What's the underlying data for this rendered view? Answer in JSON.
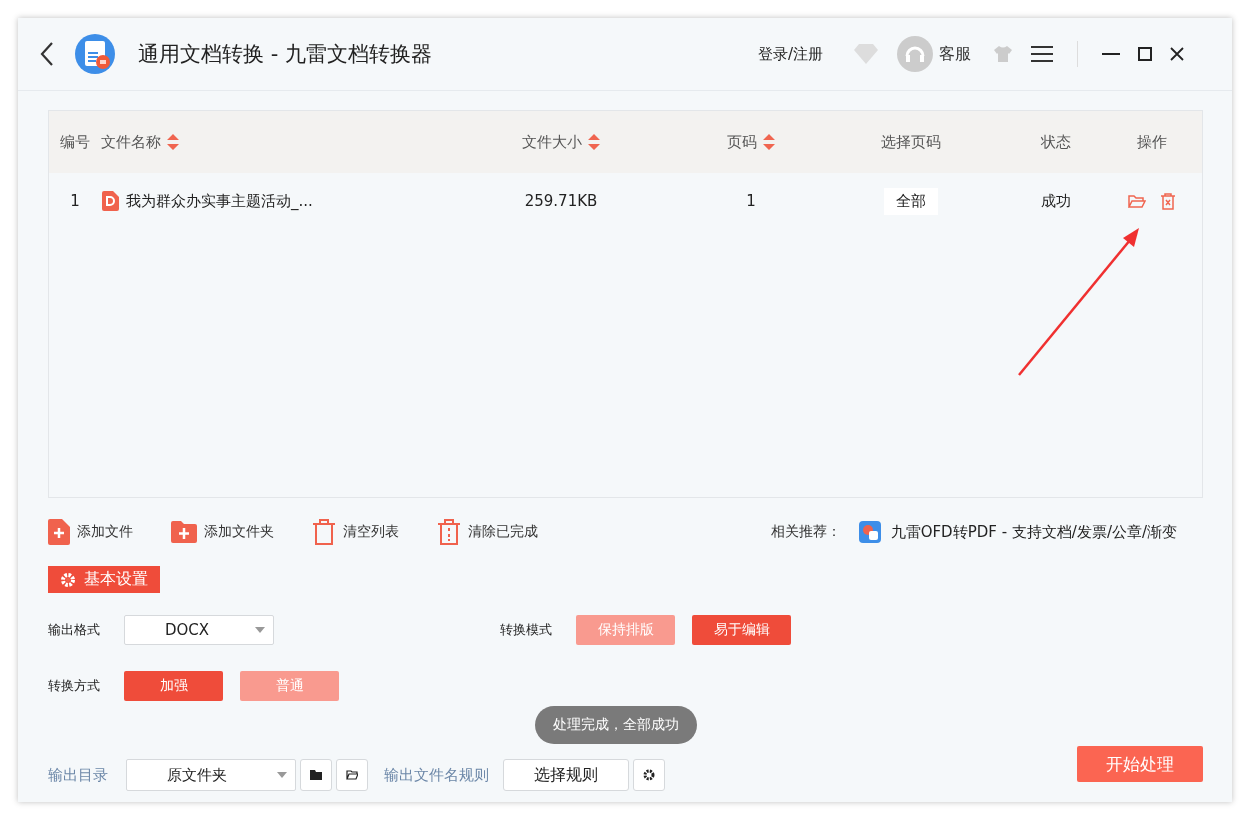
{
  "window": {
    "title": "通用文档转换 - 九雷文档转换器",
    "login": "登录/注册",
    "support": "客服"
  },
  "table": {
    "columns": [
      {
        "label": "编号",
        "sortable": false
      },
      {
        "label": "文件名称",
        "sortable": true
      },
      {
        "label": "文件大小",
        "sortable": true
      },
      {
        "label": "页码",
        "sortable": true
      },
      {
        "label": "选择页码",
        "sortable": false
      },
      {
        "label": "状态",
        "sortable": false
      },
      {
        "label": "操作",
        "sortable": false
      }
    ],
    "rows": [
      {
        "index": "1",
        "name": "我为群众办实事主题活动_...",
        "size": "259.71KB",
        "pages": "1",
        "page_select": "全部",
        "status": "成功"
      }
    ]
  },
  "toolbar": [
    {
      "kind": "file",
      "label": "添加文件"
    },
    {
      "kind": "folder",
      "label": "添加文件夹"
    },
    {
      "kind": "trash",
      "label": "清空列表"
    },
    {
      "kind": "clear",
      "label": "清除已完成"
    }
  ],
  "recommend": {
    "label": "相关推荐：",
    "link": "九雷OFD转PDF - 支持文档/发票/公章/渐变"
  },
  "settings": {
    "title": "基本设置",
    "format_label": "输出格式",
    "format": "DOCX",
    "mode_label": "转换模式",
    "modes": [
      {
        "label": "保持排版",
        "selected": false
      },
      {
        "label": "易于编辑",
        "selected": true
      }
    ],
    "method_label": "转换方式",
    "methods": [
      {
        "label": "加强",
        "selected": true
      },
      {
        "label": "普通",
        "selected": false
      }
    ]
  },
  "output": {
    "dir_label": "输出目录",
    "dir": "原文件夹",
    "rule_label": "输出文件名规则",
    "rule": "选择规则"
  },
  "toast": "处理完成，全部成功",
  "start": "开始处理"
}
